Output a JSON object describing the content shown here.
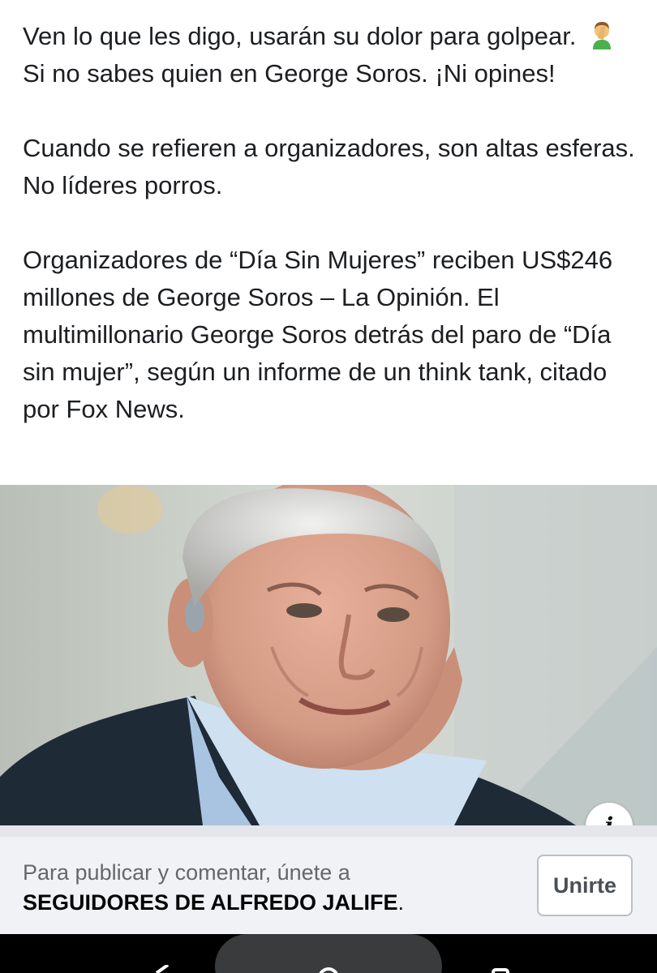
{
  "post": {
    "paragraph1_part1": "Ven lo que les digo, usarán su dolor para golpear.",
    "paragraph1_part2": "Si no sabes quien en George Soros. ¡Ni opines!",
    "paragraph1_emoji": "man-facepalming-emoji",
    "paragraph2": "Cuando se refieren a organizadores, son altas esferas. No líderes porros.",
    "paragraph3": "Organizadores de “Día Sin Mujeres” reciben US$246 millones de George Soros – La Opinión. El multimillonario George Soros detrás del paro de “Día sin mujer”, según un informe de un think tank, citado por Fox News."
  },
  "photo": {
    "icon": "info-icon",
    "info_glyph": "i"
  },
  "join_bar": {
    "prompt": "Para publicar y comentar, únete a",
    "group_name": "SEGUIDORES DE ALFREDO JALIFE",
    "group_suffix": ".",
    "join_button_label": "Unirte"
  },
  "navigation": {
    "icons": [
      "back-icon",
      "home-icon",
      "recents-icon"
    ]
  },
  "colors": {
    "text": "#1c1e21",
    "join_bar_background": "#f0f2f5",
    "nav_background": "#000000"
  }
}
